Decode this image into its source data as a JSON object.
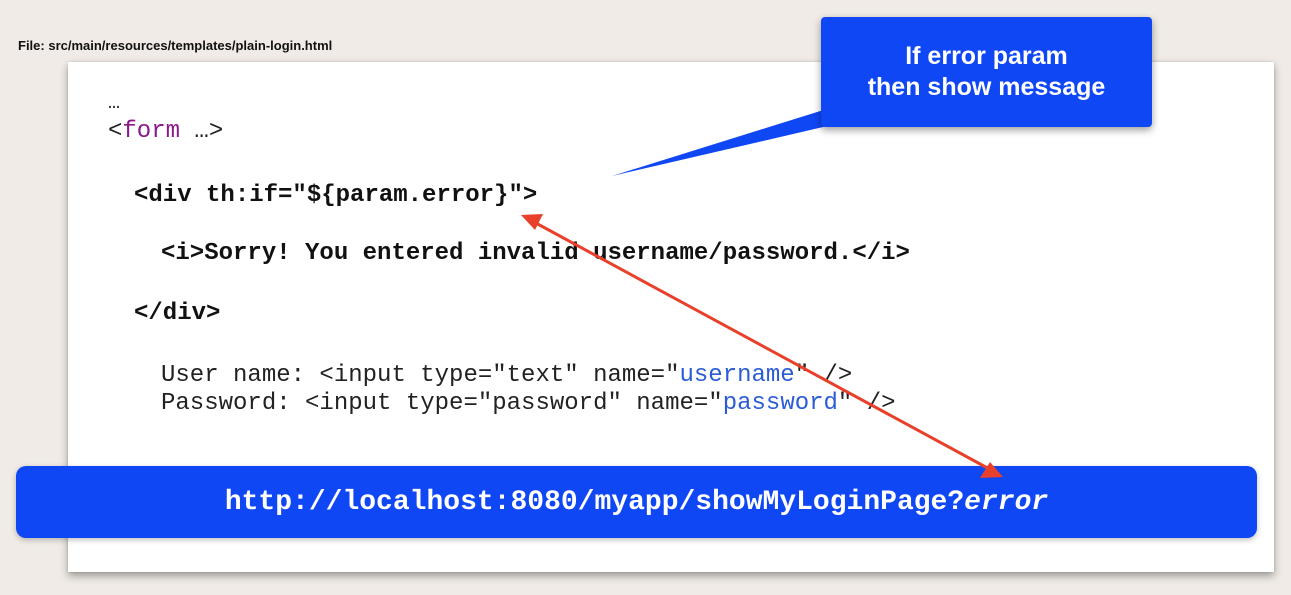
{
  "file_label": "File: src/main/resources/templates/plain-login.html",
  "code": {
    "ellipsis": "…",
    "form_tag_open": "<",
    "form_tag_name": "form",
    "form_tag_rest": " …>",
    "div_open": "<div th:if=\"${param.error}\">",
    "error_message": "<i>Sorry! You entered invalid username/password.</i>",
    "div_close": "</div>",
    "username_prefix": "User name: <input type=\"text\" name=\"",
    "username_value": "username",
    "username_suffix": "\" />",
    "password_prefix": "Password: <input type=\"password\" name=\"",
    "password_value": "password",
    "password_suffix": "\" />"
  },
  "callout": {
    "line1": "If error param",
    "line2": "then show message"
  },
  "url_banner": {
    "base": "http://localhost:8080/myapp/showMyLoginPage?",
    "param": "error"
  },
  "colors": {
    "callout_bg": "#1047f5",
    "arrow": "#e8402a",
    "tag_purple": "#8a1a8a",
    "attr_blue": "#2b5cd6"
  }
}
